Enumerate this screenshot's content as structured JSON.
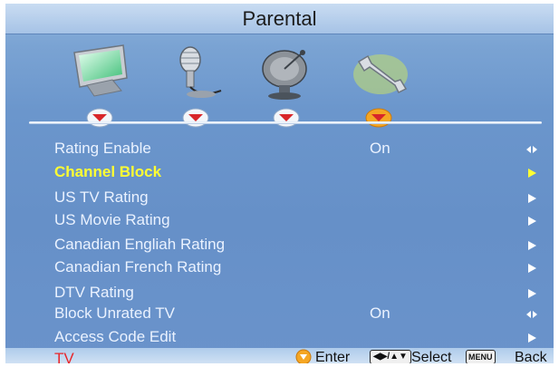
{
  "header": {
    "title": "Parental"
  },
  "categories": [
    {
      "icon": "picture-tv-icon",
      "selected": false
    },
    {
      "icon": "audio-microphone-icon",
      "selected": false
    },
    {
      "icon": "tv-satellite-dish-icon",
      "selected": false
    },
    {
      "icon": "settings-wrench-icon",
      "selected": true
    }
  ],
  "menu": {
    "items": [
      {
        "label": "Rating Enable",
        "value": "On",
        "arrow": "left-right"
      },
      {
        "label": "Channel Block",
        "value": "",
        "arrow": "right",
        "selected": true
      },
      {
        "label": "US TV Rating",
        "value": "",
        "arrow": "right"
      },
      {
        "label": "US Movie Rating",
        "value": "",
        "arrow": "right"
      },
      {
        "label": "Canadian Engliah Rating",
        "value": "",
        "arrow": "right"
      },
      {
        "label": "Canadian French Rating",
        "value": "",
        "arrow": "right"
      },
      {
        "label": "DTV Rating",
        "value": "",
        "arrow": "right"
      },
      {
        "label": "Block Unrated TV",
        "value": "On",
        "arrow": "left-right"
      },
      {
        "label": "Access Code Edit",
        "value": "",
        "arrow": "right"
      }
    ]
  },
  "footer": {
    "source": "TV",
    "enter_label": "Enter",
    "nav_key": "◀▶/▲▼",
    "select_label": "Select",
    "menu_key": "MENU",
    "back_label": "Back"
  },
  "colors": {
    "background": "#6690c8",
    "selected_text": "#ffff33",
    "text": "#eaf2ff",
    "source_text": "#e8262a",
    "marker_orange": "#f5a623",
    "marker_red": "#d8262a"
  }
}
